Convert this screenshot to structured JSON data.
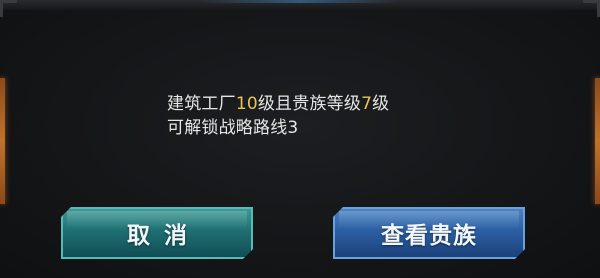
{
  "dialog": {
    "message": {
      "line1_prefix": "建筑工厂",
      "line1_value1": "10",
      "line1_middle": "级且贵族等级",
      "line1_value2": "7",
      "line1_suffix": "级",
      "line2": "可解锁战略路线3"
    },
    "buttons": {
      "cancel_label": "取消",
      "view_noble_label": "查看贵族"
    },
    "colors": {
      "highlight": "#e8c45a",
      "cancel_button": "#1f6f72",
      "view_noble_button": "#2b5fa3"
    }
  }
}
